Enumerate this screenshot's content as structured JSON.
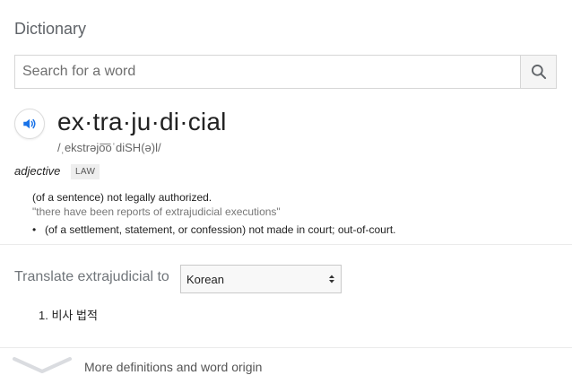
{
  "title": "Dictionary",
  "search": {
    "placeholder": "Search for a word",
    "icon": "search-icon"
  },
  "entry": {
    "speaker_icon": "speaker-icon",
    "headword": "ex·tra·ju·di·cial",
    "phonetic": "/ˌekstrəjo͞oˈdiSH(ə)l/",
    "part_of_speech": "adjective",
    "tag": "LAW",
    "definition": "(of a sentence) not legally authorized.",
    "example": "\"there have been reports of extrajudicial executions\"",
    "subdefinition": "(of a settlement, statement, or confession) not made in court; out-of-court."
  },
  "translate": {
    "label": "Translate extrajudicial to",
    "selected_language": "Korean",
    "results": [
      "1. 비사 법적"
    ]
  },
  "more": {
    "label": "More definitions and word origin",
    "icon": "chevron-down-icon"
  },
  "colors": {
    "accent_blue": "#1a73e8",
    "muted_text": "#70757a",
    "divider": "#ebebeb"
  }
}
